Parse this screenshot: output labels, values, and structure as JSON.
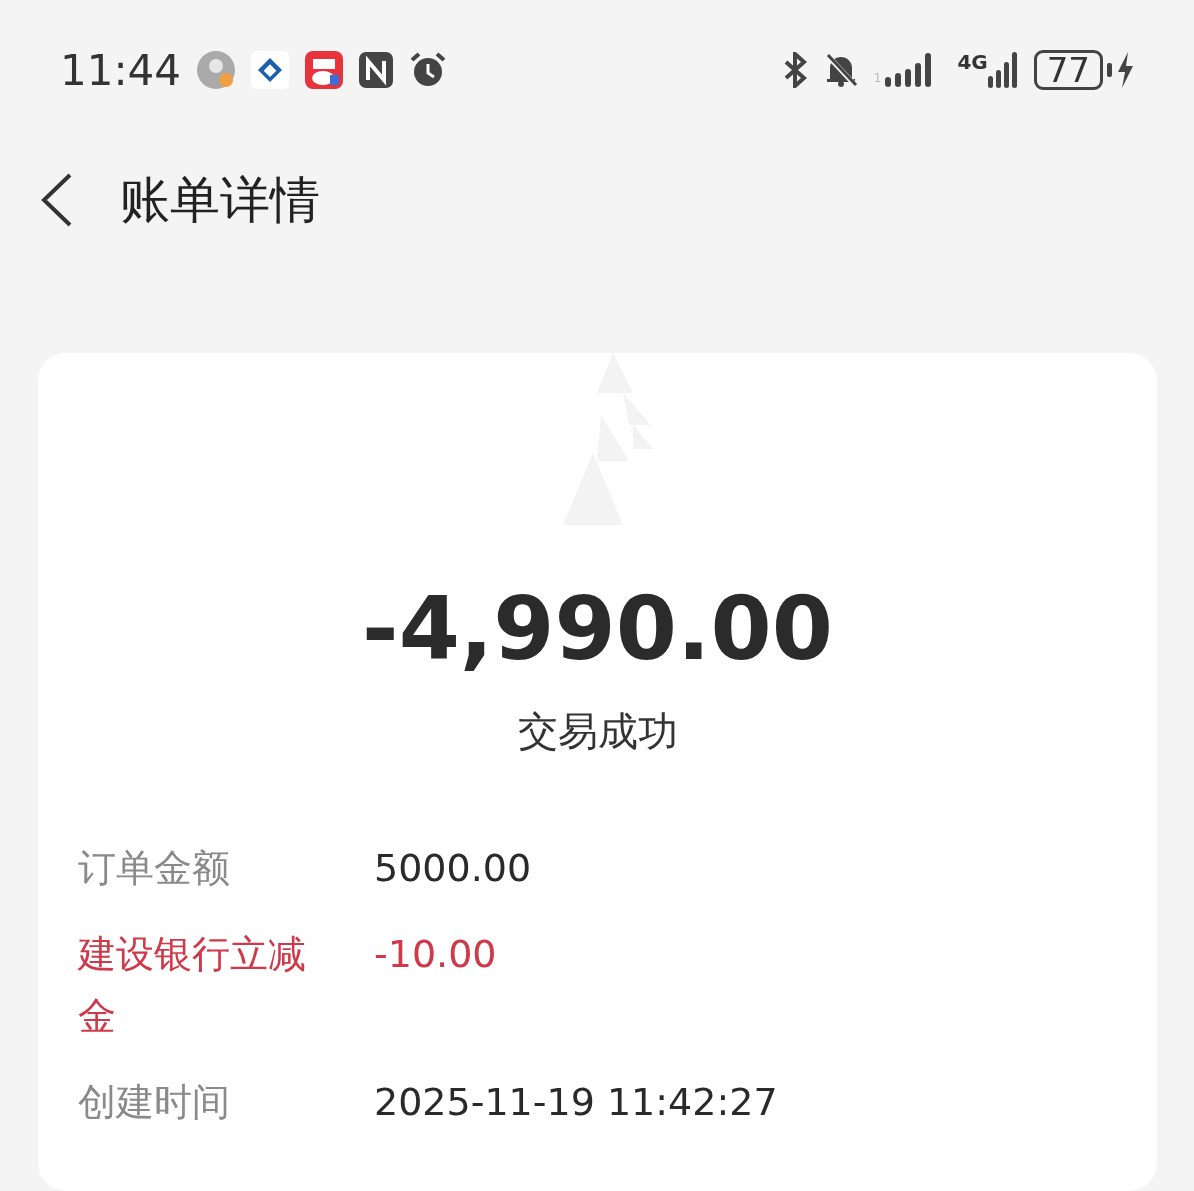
{
  "status_bar": {
    "time": "11:44",
    "sim_label": "1",
    "network": "4G",
    "battery": "77"
  },
  "header": {
    "title": "账单详情"
  },
  "bill": {
    "amount": "-4,990.00",
    "status": "交易成功",
    "rows": [
      {
        "kind": "normal",
        "label": "订单金额",
        "value": "5000.00"
      },
      {
        "kind": "discount",
        "label": "建设银行立减金",
        "value": "-10.00"
      },
      {
        "kind": "normal",
        "label": "创建时间",
        "value": "2025-11-19 11:42:27"
      }
    ]
  }
}
